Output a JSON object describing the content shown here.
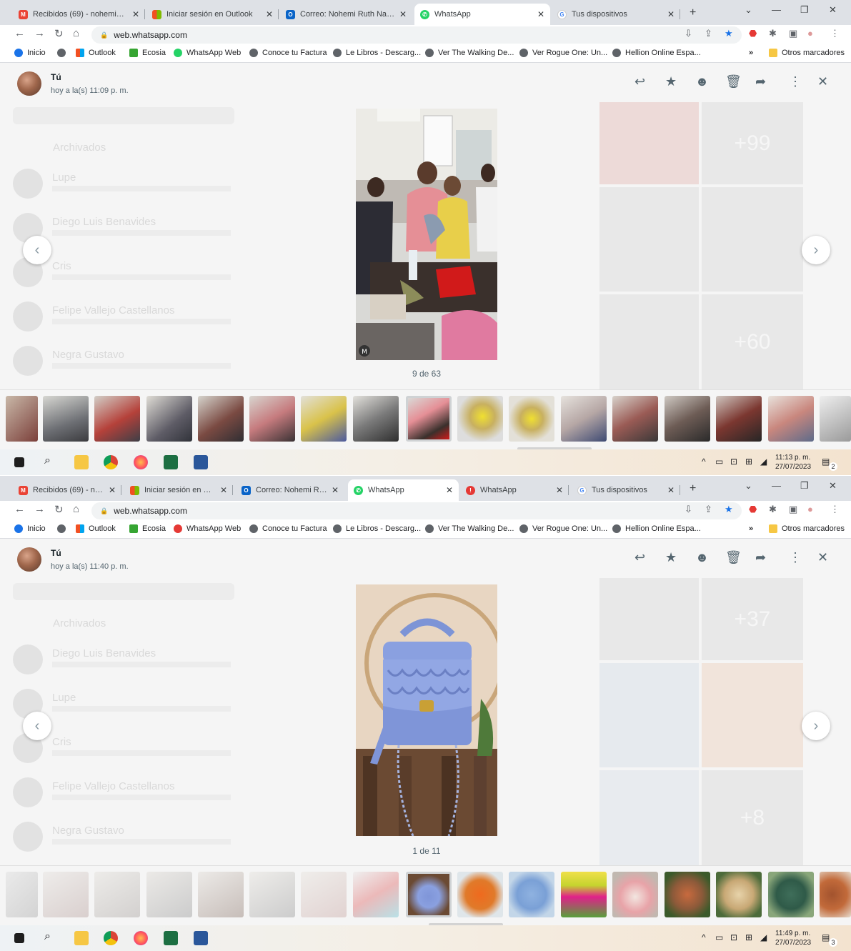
{
  "screens": [
    {
      "tabs": [
        {
          "title": "Recibidos (69) - noheminaju"
        },
        {
          "title": "Iniciar sesión en Outlook"
        },
        {
          "title": "Correo: Nohemi Ruth Navarr"
        },
        {
          "title": "WhatsApp"
        },
        {
          "title": "Tus dispositivos"
        }
      ],
      "url": "web.whatsapp.com",
      "bookmarks": [
        "Inicio",
        "Outlook",
        "Ecosia",
        "WhatsApp Web",
        "Conoce tu Factura",
        "Le Libros - Descarg...",
        "Ver The Walking De...",
        "Ver Rogue One: Un...",
        "Hellion Online Espa..."
      ],
      "bookmarks_more": "»",
      "other_bookmarks": "Otros marcadores",
      "sender": "Tú",
      "time": "hoy a la(s) 11:09 p. m.",
      "counter": "9 de 63",
      "clock_time": "11:13 p. m.",
      "clock_date": "27/07/2023",
      "notifications": "2",
      "background_chats": [
        "Archivados",
        "Lupe",
        "Diego Luis Benavides",
        "Cris",
        "Felipe Vallejo Castellanos",
        "Negra Gustavo"
      ],
      "background_counts": [
        "+99",
        "+60"
      ]
    },
    {
      "tabs": [
        {
          "title": "Recibidos (69) - nohe"
        },
        {
          "title": "Iniciar sesión en Outlo"
        },
        {
          "title": "Correo: Nohemi Ruth"
        },
        {
          "title": "WhatsApp"
        },
        {
          "title": "WhatsApp"
        },
        {
          "title": "Tus dispositivos"
        }
      ],
      "url": "web.whatsapp.com",
      "bookmarks": [
        "Inicio",
        "Outlook",
        "Ecosia",
        "WhatsApp Web",
        "Conoce tu Factura",
        "Le Libros - Descarg...",
        "Ver The Walking De...",
        "Ver Rogue One: Un...",
        "Hellion Online Espa..."
      ],
      "bookmarks_more": "»",
      "other_bookmarks": "Otros marcadores",
      "sender": "Tú",
      "time": "hoy a la(s) 11:40 p. m.",
      "counter": "1 de 11",
      "clock_time": "11:49 p. m.",
      "clock_date": "27/07/2023",
      "notifications": "3",
      "background_chats": [
        "Archivados",
        "Diego Luis Benavides",
        "Lupe",
        "Cris",
        "Felipe Vallejo Castellanos",
        "Negra Gustavo"
      ],
      "background_counts": [
        "+37",
        "+8"
      ]
    }
  ],
  "toolbar_icons": [
    "reply-icon",
    "star-icon",
    "emoji-icon",
    "delete-icon",
    "forward-icon",
    "more-icon",
    "close-icon"
  ],
  "colors": {
    "whatsapp_green": "#25d366",
    "tabstrip": "#dee1e6",
    "viewer_bg": "#f5f5f5"
  }
}
